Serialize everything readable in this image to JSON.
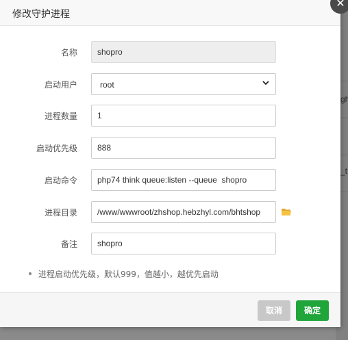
{
  "dialog": {
    "title": "修改守护进程",
    "close_glyph": "✕"
  },
  "form": {
    "name": {
      "label": "名称",
      "value": "shopro"
    },
    "user": {
      "label": "启动用户",
      "value": "root"
    },
    "num_procs": {
      "label": "进程数量",
      "value": "1"
    },
    "priority": {
      "label": "启动优先级",
      "value": "888"
    },
    "command": {
      "label": "启动命令",
      "value": "php74 think queue:listen --queue  shopro"
    },
    "directory": {
      "label": "进程目录",
      "value": "/www/wwwroot/zhshop.hebzhyl.com/bhtshop"
    },
    "remark": {
      "label": "备注",
      "value": "shopro"
    }
  },
  "tips": "进程启动优先级，默认999，值越小，越优先启动",
  "footer": {
    "cancel_label": "取消",
    "ok_label": "确定"
  },
  "background": {
    "fragments": [
      "gh",
      "_t"
    ]
  },
  "colors": {
    "primary": "#20a53a",
    "cancel": "#c8c8c8",
    "folder": "#f5c242"
  },
  "icons": {
    "close": "close-icon",
    "folder": "folder-icon",
    "dropdown": "chevron-down-icon"
  }
}
